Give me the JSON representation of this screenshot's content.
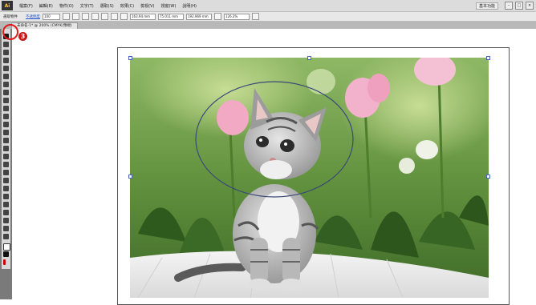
{
  "app": {
    "logo": "Ai",
    "menus": [
      "檔案(F)",
      "編輯(E)",
      "物件(O)",
      "文字(T)",
      "選取(S)",
      "效果(C)",
      "檢視(V)",
      "視窗(W)",
      "說明(H)"
    ],
    "workspace": "基本功能"
  },
  "controlbar": {
    "label": "選取物件",
    "link": "不透明度",
    "opacity": "100",
    "x": "163.94 mm",
    "y": "75.011 mm",
    "w": "192.969 mm",
    "h": "126.3%"
  },
  "document": {
    "tab_label": "未命名-1* @ 200% (CMYK/預視)"
  },
  "annotation": {
    "step": "3"
  }
}
